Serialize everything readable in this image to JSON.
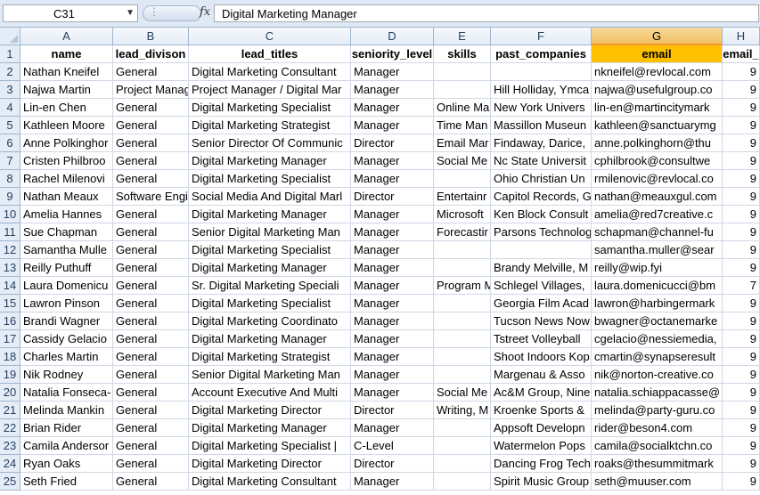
{
  "formula_bar": {
    "name_box": "C31",
    "fx_label": "fx",
    "formula": "Digital Marketing Manager"
  },
  "columns": [
    "A",
    "B",
    "C",
    "D",
    "E",
    "F",
    "G",
    "H"
  ],
  "selected_column": "G",
  "headers": [
    "name",
    "lead_divison",
    "lead_titles",
    "seniority_level",
    "skills",
    "past_companies",
    "email",
    "email_"
  ],
  "rows": [
    {
      "num": "1"
    },
    {
      "num": "2",
      "cells": [
        "Nathan Kneifel",
        "General",
        "Digital Marketing Consultant",
        "Manager",
        "",
        "",
        "nkneifel@revlocal.com",
        "9"
      ]
    },
    {
      "num": "3",
      "cells": [
        "Najwa Martin",
        "Project Manag",
        "Project Manager / Digital Mar",
        "Manager",
        "",
        "Hill Holliday, Ymca",
        "najwa@usefulgroup.co",
        "9"
      ]
    },
    {
      "num": "4",
      "cells": [
        "Lin-en Chen",
        "General",
        "Digital Marketing Specialist",
        "Manager",
        "Online Ma",
        "New York Univers",
        "lin-en@martincitymark",
        "9"
      ]
    },
    {
      "num": "5",
      "cells": [
        "Kathleen Moore",
        "General",
        "Digital Marketing Strategist",
        "Manager",
        "Time Man",
        "Massillon Museun",
        "kathleen@sanctuarymg",
        "9"
      ]
    },
    {
      "num": "6",
      "cells": [
        "Anne Polkinghor",
        "General",
        "Senior Director Of Communic",
        "Director",
        "Email Mar",
        "Findaway, Darice,",
        "anne.polkinghorn@thu",
        "9"
      ]
    },
    {
      "num": "7",
      "cells": [
        "Cristen Philbroo",
        "General",
        "Digital Marketing Manager",
        "Manager",
        "Social Me",
        "Nc State Universit",
        "cphilbrook@consultwe",
        "9"
      ]
    },
    {
      "num": "8",
      "cells": [
        "Rachel Milenovi",
        "General",
        "Digital Marketing Specialist",
        "Manager",
        "",
        "Ohio Christian Un",
        "rmilenovic@revlocal.co",
        "9"
      ]
    },
    {
      "num": "9",
      "cells": [
        "Nathan Meaux",
        "Software Engi",
        "Social Media And Digital Marl",
        "Director",
        "Entertainr",
        "Capitol Records, G",
        "nathan@meauxgul.com",
        "9"
      ]
    },
    {
      "num": "10",
      "cells": [
        "Amelia Hannes",
        "General",
        "Digital Marketing Manager",
        "Manager",
        "Microsoft",
        "Ken Block Consult",
        "amelia@red7creative.c",
        "9"
      ]
    },
    {
      "num": "11",
      "cells": [
        "Sue Chapman",
        "General",
        "Senior Digital Marketing Man",
        "Manager",
        "Forecastir",
        "Parsons Technolog",
        "schapman@channel-fu",
        "9"
      ]
    },
    {
      "num": "12",
      "cells": [
        "Samantha Mulle",
        "General",
        "Digital Marketing Specialist",
        "Manager",
        "",
        "",
        "samantha.muller@sear",
        "9"
      ]
    },
    {
      "num": "13",
      "cells": [
        "Reilly Puthuff",
        "General",
        "Digital Marketing Manager",
        "Manager",
        "",
        "Brandy Melville, M",
        "reilly@wip.fyi",
        "9"
      ]
    },
    {
      "num": "14",
      "cells": [
        "Laura Domenicu",
        "General",
        "Sr. Digital Marketing Speciali",
        "Manager",
        "Program M",
        "Schlegel Villages,",
        "laura.domenicucci@bm",
        "7"
      ]
    },
    {
      "num": "15",
      "cells": [
        "Lawron Pinson",
        "General",
        "Digital Marketing Specialist",
        "Manager",
        "",
        "Georgia Film Acad",
        "lawron@harbingermark",
        "9"
      ]
    },
    {
      "num": "16",
      "cells": [
        "Brandi Wagner",
        "General",
        "Digital Marketing Coordinato",
        "Manager",
        "",
        "Tucson News Now",
        "bwagner@octanemarke",
        "9"
      ]
    },
    {
      "num": "17",
      "cells": [
        "Cassidy Gelacio",
        "General",
        "Digital Marketing Manager",
        "Manager",
        "",
        "Tstreet Volleyball",
        "cgelacio@nessiemedia,",
        "9"
      ]
    },
    {
      "num": "18",
      "cells": [
        "Charles Martin",
        "General",
        "Digital Marketing Strategist",
        "Manager",
        "",
        "Shoot Indoors Kop",
        "cmartin@synapseresult",
        "9"
      ]
    },
    {
      "num": "19",
      "cells": [
        "Nik Rodney",
        "General",
        "Senior Digital Marketing Man",
        "Manager",
        "",
        "Margenau & Asso",
        "nik@norton-creative.co",
        "9"
      ]
    },
    {
      "num": "20",
      "cells": [
        "Natalia Fonseca-",
        "General",
        "Account Executive And Multi",
        "Manager",
        "Social Me",
        "Ac&M Group, Nine",
        "natalia.schiappacasse@",
        "9"
      ]
    },
    {
      "num": "21",
      "cells": [
        "Melinda Mankin",
        "General",
        "Digital Marketing Director",
        "Director",
        "Writing, M",
        "Kroenke Sports &",
        "melinda@party-guru.co",
        "9"
      ]
    },
    {
      "num": "22",
      "cells": [
        "Brian Rider",
        "General",
        "Digital Marketing Manager",
        "Manager",
        "",
        "Appsoft Developn",
        "rider@beson4.com",
        "9"
      ]
    },
    {
      "num": "23",
      "cells": [
        "Camila Andersor",
        "General",
        "Digital Marketing Specialist |",
        "C-Level",
        "",
        "Watermelon Pops",
        "camila@socialktchn.co",
        "9"
      ]
    },
    {
      "num": "24",
      "cells": [
        "Ryan Oaks",
        "General",
        "Digital Marketing Director",
        "Director",
        "",
        "Dancing Frog Tech",
        "roaks@thesummitmark",
        "9"
      ]
    },
    {
      "num": "25",
      "cells": [
        "Seth Fried",
        "General",
        "Digital Marketing Consultant",
        "Manager",
        "",
        "Spirit Music Group",
        "seth@muuser.com",
        "9"
      ]
    }
  ]
}
